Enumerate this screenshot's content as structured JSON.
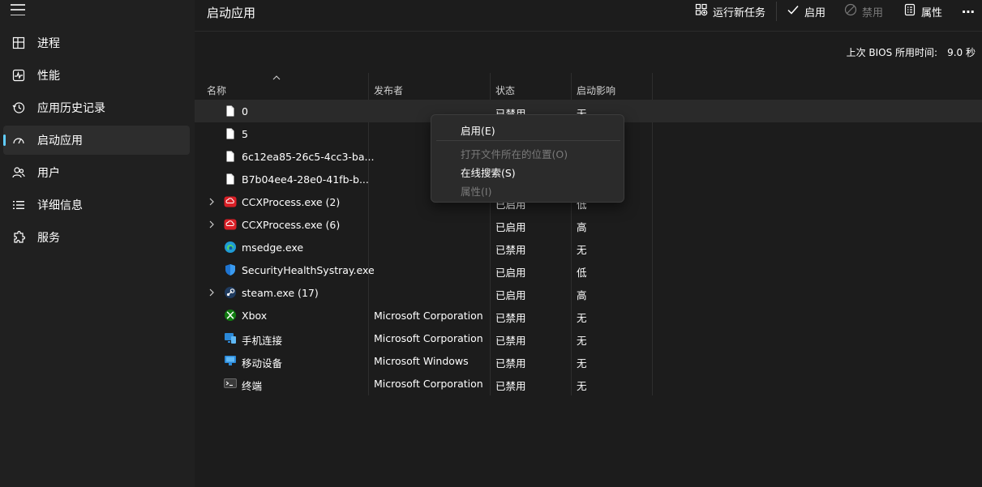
{
  "sidebar": {
    "items": [
      {
        "label": "进程",
        "icon": "processes-icon"
      },
      {
        "label": "性能",
        "icon": "performance-icon"
      },
      {
        "label": "应用历史记录",
        "icon": "app-history-icon"
      },
      {
        "label": "启动应用",
        "icon": "startup-apps-icon",
        "active": true
      },
      {
        "label": "用户",
        "icon": "users-icon"
      },
      {
        "label": "详细信息",
        "icon": "details-icon"
      },
      {
        "label": "服务",
        "icon": "services-icon"
      }
    ],
    "accent": "#60cdff"
  },
  "header": {
    "title": "启动应用",
    "run_new_task": "运行新任务",
    "enable": "启用",
    "disable": "禁用",
    "properties": "属性",
    "more": "⋯"
  },
  "bios": {
    "label": "上次 BIOS 所用时间:",
    "value": "9.0 秒"
  },
  "table": {
    "columns": [
      "名称",
      "发布者",
      "状态",
      "启动影响"
    ],
    "rows": [
      {
        "name": "0",
        "publisher": "",
        "status": "已禁用",
        "impact": "无",
        "icon": "file-icon",
        "expandable": false
      },
      {
        "name": "5",
        "publisher": "",
        "status": "",
        "impact": "",
        "icon": "file-icon",
        "expandable": false
      },
      {
        "name": "6c12ea85-26c5-4cc3-ba...",
        "publisher": "",
        "status": "",
        "impact": "",
        "icon": "file-icon",
        "expandable": false
      },
      {
        "name": "B7b04ee4-28e0-41fb-b...",
        "publisher": "",
        "status": "",
        "impact": "",
        "icon": "file-icon",
        "expandable": false
      },
      {
        "name": "CCXProcess.exe (2)",
        "publisher": "",
        "status": "已启用",
        "impact": "低",
        "icon": "creative-cloud-icon",
        "expandable": true
      },
      {
        "name": "CCXProcess.exe (6)",
        "publisher": "",
        "status": "已启用",
        "impact": "高",
        "icon": "creative-cloud-icon",
        "expandable": true
      },
      {
        "name": "msedge.exe",
        "publisher": "",
        "status": "已禁用",
        "impact": "无",
        "icon": "edge-icon",
        "expandable": false
      },
      {
        "name": "SecurityHealthSystray.exe",
        "publisher": "",
        "status": "已启用",
        "impact": "低",
        "icon": "shield-icon",
        "expandable": false
      },
      {
        "name": "steam.exe (17)",
        "publisher": "",
        "status": "已启用",
        "impact": "高",
        "icon": "steam-icon",
        "expandable": true
      },
      {
        "name": "Xbox",
        "publisher": "Microsoft Corporation",
        "status": "已禁用",
        "impact": "无",
        "icon": "xbox-icon",
        "expandable": false
      },
      {
        "name": "手机连接",
        "publisher": "Microsoft Corporation",
        "status": "已禁用",
        "impact": "无",
        "icon": "phone-link-icon",
        "expandable": false
      },
      {
        "name": "移动设备",
        "publisher": "Microsoft Windows",
        "status": "已禁用",
        "impact": "无",
        "icon": "mobile-devices-icon",
        "expandable": false
      },
      {
        "name": "终端",
        "publisher": "Microsoft Corporation",
        "status": "已禁用",
        "impact": "无",
        "icon": "terminal-icon",
        "expandable": false
      }
    ]
  },
  "context_menu": {
    "items": [
      {
        "label": "启用(E)",
        "enabled": true
      },
      {
        "label": "打开文件所在的位置(O)",
        "enabled": false
      },
      {
        "label": "在线搜索(S)",
        "enabled": true
      },
      {
        "label": "属性(I)",
        "enabled": false
      }
    ]
  }
}
